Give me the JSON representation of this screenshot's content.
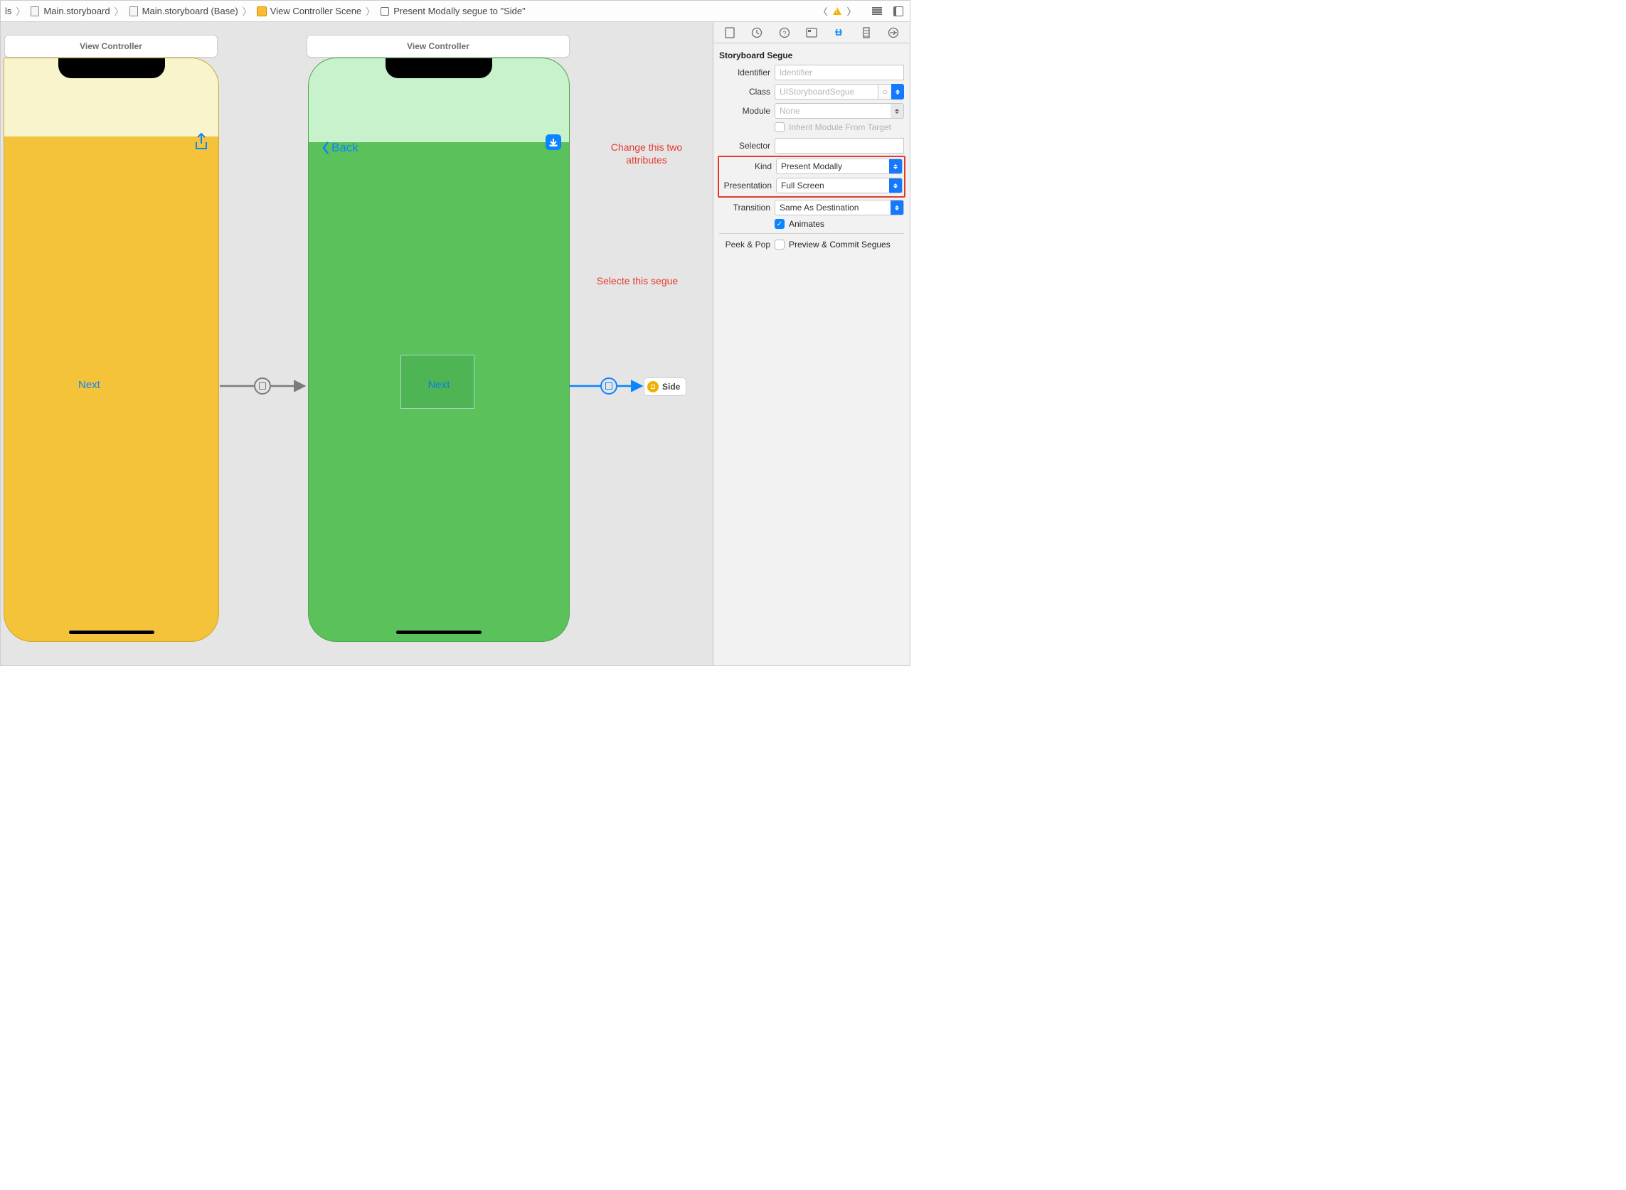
{
  "breadcrumb": {
    "item0": "ls",
    "item1": "Main.storyboard",
    "item2": "Main.storyboard (Base)",
    "item3": "View Controller Scene",
    "item4": "Present Modally segue to \"Side\""
  },
  "canvas": {
    "scene1": {
      "title": "View Controller",
      "next_label": "Next"
    },
    "scene2": {
      "title": "View Controller",
      "back_label": "Back",
      "next_label": "Next"
    },
    "side_chip": "Side"
  },
  "annotations": {
    "change_attr": "Change this two attributes",
    "select_segue": "Selecte this segue"
  },
  "inspector": {
    "section": "Storyboard Segue",
    "identifier_label": "Identifier",
    "identifier_placeholder": "Identifier",
    "class_label": "Class",
    "class_placeholder": "UIStoryboardSegue",
    "module_label": "Module",
    "module_value": "None",
    "inherit_label": "Inherit Module From Target",
    "selector_label": "Selector",
    "kind_label": "Kind",
    "kind_value": "Present Modally",
    "presentation_label": "Presentation",
    "presentation_value": "Full Screen",
    "transition_label": "Transition",
    "transition_value": "Same As Destination",
    "animates_label": "Animates",
    "peek_label": "Peek & Pop",
    "peek_value": "Preview & Commit Segues"
  }
}
